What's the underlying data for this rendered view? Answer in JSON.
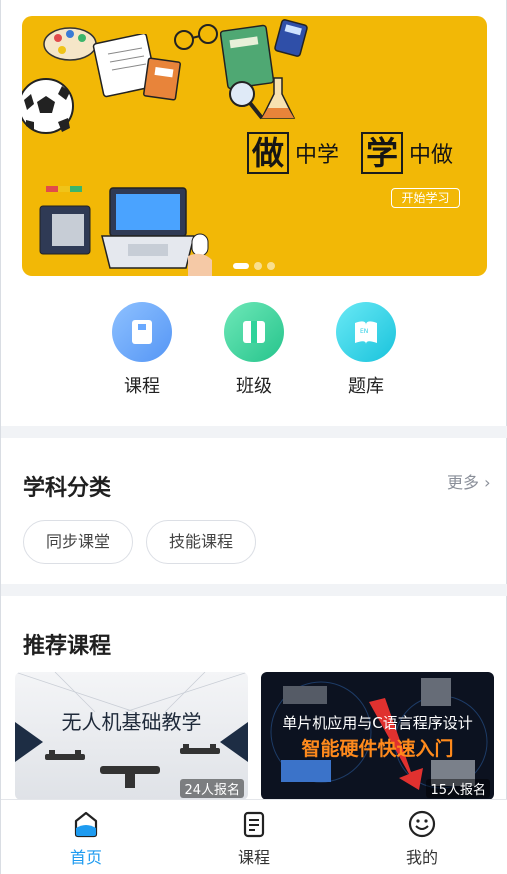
{
  "banner": {
    "slogan_big_1": "做",
    "slogan_small_1": "中学",
    "slogan_big_2": "学",
    "slogan_small_2": "中做",
    "start_button": "开始学习"
  },
  "quick_entries": [
    {
      "label": "课程",
      "icon": "book-icon",
      "color": "#6aa9ff"
    },
    {
      "label": "班级",
      "icon": "class-icon",
      "color": "#2fd39a"
    },
    {
      "label": "题库",
      "icon": "question-bank-icon",
      "color": "#2ed0e6"
    }
  ],
  "subject_section": {
    "title": "学科分类",
    "more": "更多",
    "chips": [
      "同步课堂",
      "技能课程"
    ]
  },
  "recommend_section": {
    "title": "推荐课程",
    "cards": [
      {
        "title": "无人机基础教学",
        "enroll": "24人报名"
      },
      {
        "title": "单片机应用与C语言程序设计",
        "subtitle": "智能硬件快速入门",
        "enroll": "15人报名"
      }
    ]
  },
  "tabbar": {
    "items": [
      {
        "label": "首页",
        "icon": "home-icon",
        "active": true
      },
      {
        "label": "课程",
        "icon": "course-icon",
        "active": false
      },
      {
        "label": "我的",
        "icon": "smiley-icon",
        "active": false
      }
    ]
  },
  "colors": {
    "accent": "#1e9bf0",
    "banner_bg": "#f2b806"
  }
}
